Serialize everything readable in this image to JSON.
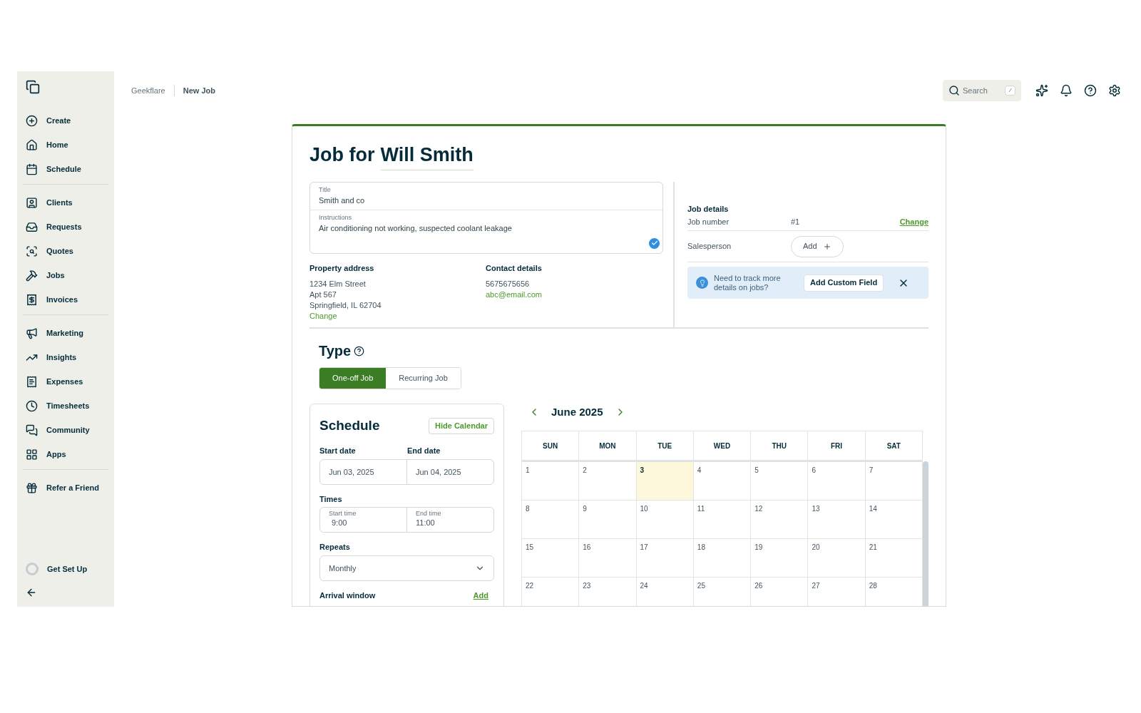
{
  "sidebar": {
    "groups": [
      [
        {
          "label": "Create"
        },
        {
          "label": "Home"
        },
        {
          "label": "Schedule"
        }
      ],
      [
        {
          "label": "Clients"
        },
        {
          "label": "Requests"
        },
        {
          "label": "Quotes"
        },
        {
          "label": "Jobs"
        },
        {
          "label": "Invoices"
        }
      ],
      [
        {
          "label": "Marketing"
        },
        {
          "label": "Insights"
        },
        {
          "label": "Expenses"
        },
        {
          "label": "Timesheets"
        },
        {
          "label": "Community"
        },
        {
          "label": "Apps"
        }
      ],
      [
        {
          "label": "Refer a Friend"
        }
      ]
    ],
    "footer": {
      "label": "Get Set Up"
    }
  },
  "breadcrumb": [
    "Geekflare",
    "New Job"
  ],
  "search": {
    "placeholder": "Search",
    "shortcut": "/"
  },
  "job": {
    "heading": "Job for",
    "client": "Will Smith",
    "title": {
      "label": "Title",
      "value": "Smith and co"
    },
    "instructions": {
      "label": "Instructions",
      "value": "Air conditioning not working, suspected coolant leakage"
    },
    "property": {
      "heading": "Property address",
      "lines": [
        "1234 Elm Street",
        "Apt 567",
        "Springfield, IL 62704"
      ],
      "link": "Change"
    },
    "contact": {
      "heading": "Contact details",
      "phone": "5675675656",
      "email": "abc@email.com"
    },
    "details": {
      "heading": "Job details",
      "number_label": "Job number",
      "number": "#1",
      "change": "Change",
      "salesperson_label": "Salesperson",
      "add": "Add"
    },
    "tip": {
      "text": "Need to track more details on jobs?",
      "button": "Add Custom Field"
    }
  },
  "type": {
    "heading": "Type",
    "options": [
      {
        "label": "One-off Job",
        "selected": true
      },
      {
        "label": "Recurring Job",
        "selected": false
      }
    ]
  },
  "schedule": {
    "heading": "Schedule",
    "toggle": "Hide Calendar",
    "start_date_label": "Start date",
    "end_date_label": "End date",
    "start_date": "Jun 03, 2025",
    "end_date": "Jun 04, 2025",
    "times_label": "Times",
    "start_time_label": "Start time",
    "start_time": "9:00",
    "end_time_label": "End time",
    "end_time": "11:00",
    "repeats_label": "Repeats",
    "repeats": "Monthly",
    "arrival_label": "Arrival window",
    "arrival_add": "Add"
  },
  "calendar": {
    "month": "June 2025",
    "weekdays": [
      "SUN",
      "MON",
      "TUE",
      "WED",
      "THU",
      "FRI",
      "SAT"
    ],
    "weeks": [
      [
        {
          "day": "1",
          "selected": false
        },
        {
          "day": "2",
          "selected": false
        },
        {
          "day": "3",
          "selected": true
        },
        {
          "day": "4",
          "selected": false
        },
        {
          "day": "5",
          "selected": false
        },
        {
          "day": "6",
          "selected": false
        },
        {
          "day": "7",
          "selected": false
        }
      ],
      [
        {
          "day": "8",
          "selected": false
        },
        {
          "day": "9",
          "selected": false
        },
        {
          "day": "10",
          "selected": false
        },
        {
          "day": "11",
          "selected": false
        },
        {
          "day": "12",
          "selected": false
        },
        {
          "day": "13",
          "selected": false
        },
        {
          "day": "14",
          "selected": false
        }
      ],
      [
        {
          "day": "15",
          "selected": false
        },
        {
          "day": "16",
          "selected": false
        },
        {
          "day": "17",
          "selected": false
        },
        {
          "day": "18",
          "selected": false
        },
        {
          "day": "19",
          "selected": false
        },
        {
          "day": "20",
          "selected": false
        },
        {
          "day": "21",
          "selected": false
        }
      ],
      [
        {
          "day": "22",
          "selected": false
        },
        {
          "day": "23",
          "selected": false
        },
        {
          "day": "24",
          "selected": false
        },
        {
          "day": "25",
          "selected": false
        },
        {
          "day": "26",
          "selected": false
        },
        {
          "day": "27",
          "selected": false
        },
        {
          "day": "28",
          "selected": false
        }
      ]
    ]
  }
}
